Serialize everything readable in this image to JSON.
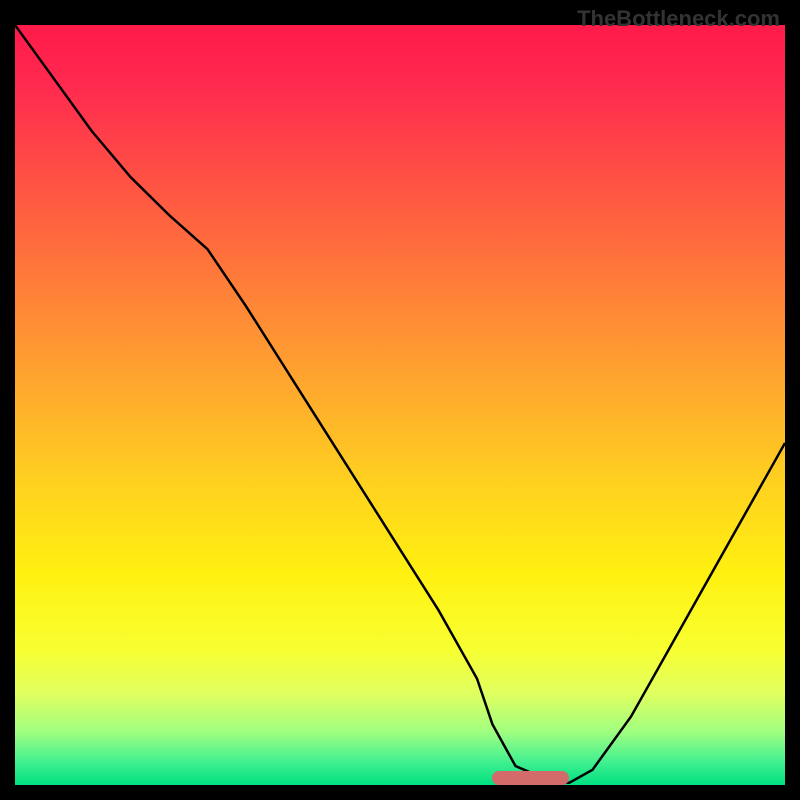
{
  "watermark": "TheBottleneck.com",
  "chart_data": {
    "type": "line",
    "title": "",
    "xlabel": "",
    "ylabel": "",
    "xlim": [
      0,
      100
    ],
    "ylim": [
      0,
      100
    ],
    "x": [
      0,
      5,
      10,
      15,
      20,
      25,
      30,
      35,
      40,
      45,
      50,
      55,
      60,
      62,
      65,
      70,
      72,
      75,
      80,
      85,
      90,
      95,
      100
    ],
    "values": [
      100,
      93,
      86,
      80,
      75,
      70.5,
      63,
      55,
      47,
      39,
      31,
      23,
      14,
      8,
      2.5,
      0.3,
      0.3,
      2,
      9,
      18,
      27,
      36,
      45
    ],
    "optimal_range_x": [
      62,
      72
    ],
    "gradient_stops": [
      {
        "pos": 0,
        "color": "#ff1a4a"
      },
      {
        "pos": 0.08,
        "color": "#ff2a4f"
      },
      {
        "pos": 0.25,
        "color": "#ff6040"
      },
      {
        "pos": 0.45,
        "color": "#ffa030"
      },
      {
        "pos": 0.6,
        "color": "#ffd020"
      },
      {
        "pos": 0.72,
        "color": "#fff010"
      },
      {
        "pos": 0.82,
        "color": "#f8ff30"
      },
      {
        "pos": 0.88,
        "color": "#e0ff60"
      },
      {
        "pos": 0.93,
        "color": "#a0ff80"
      },
      {
        "pos": 0.97,
        "color": "#40f090"
      },
      {
        "pos": 1.0,
        "color": "#00e080"
      }
    ]
  }
}
